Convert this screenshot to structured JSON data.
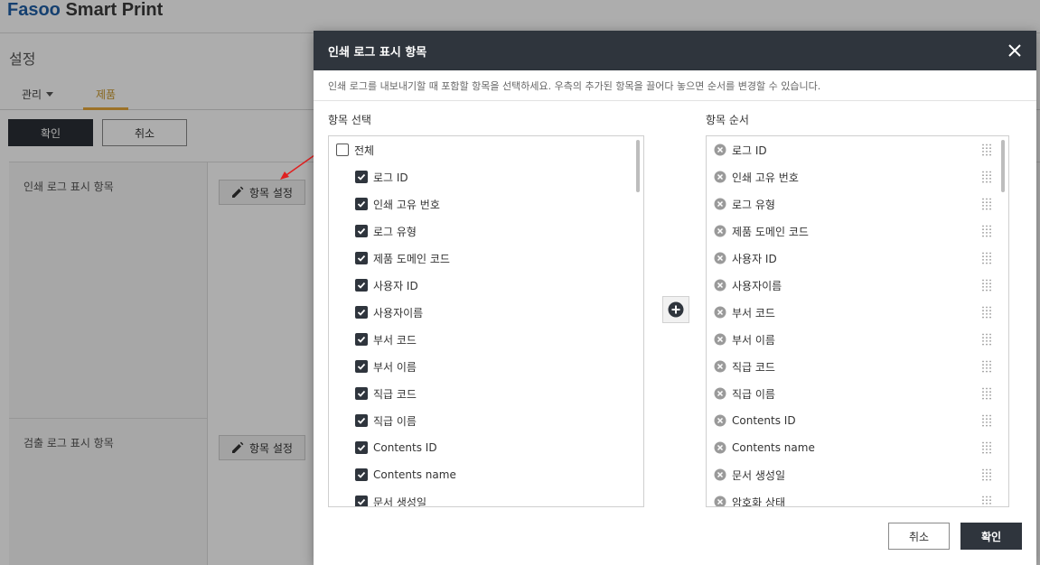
{
  "app": {
    "logo_brand": "Fasoo",
    "logo_product": " Smart Print",
    "page_title": "설정",
    "tabs": [
      {
        "label": "관리"
      },
      {
        "label": "제품"
      }
    ],
    "confirm_label": "확인",
    "cancel_label": "취소",
    "rows": [
      {
        "label": "인쇄 로그 표시 항목",
        "button_label": "항목 설정"
      },
      {
        "label": "검출 로그 표시 항목",
        "button_label": "항목 설정"
      }
    ]
  },
  "modal": {
    "title": "인쇄 로그 표시 항목",
    "description": "인쇄 로그를 내보내기할 때 포함할 항목을 선택하세요. 우측의 추가된 항목을 끌어다 놓으면 순서를 변경할 수 있습니다.",
    "select_label": "항목 선택",
    "order_label": "항목 순서",
    "select_all_label": "전체",
    "select_items": [
      {
        "label": "로그 ID",
        "checked": true
      },
      {
        "label": "인쇄 고유 번호",
        "checked": true
      },
      {
        "label": "로그 유형",
        "checked": true
      },
      {
        "label": "제품 도메인 코드",
        "checked": true
      },
      {
        "label": "사용자 ID",
        "checked": true
      },
      {
        "label": "사용자이름",
        "checked": true
      },
      {
        "label": "부서 코드",
        "checked": true
      },
      {
        "label": "부서 이름",
        "checked": true
      },
      {
        "label": "직급 코드",
        "checked": true
      },
      {
        "label": "직급 이름",
        "checked": true
      },
      {
        "label": "Contents ID",
        "checked": true
      },
      {
        "label": "Contents name",
        "checked": true
      },
      {
        "label": "문서 생성일",
        "checked": true
      }
    ],
    "order_items": [
      {
        "label": "로그 ID"
      },
      {
        "label": "인쇄 고유 번호"
      },
      {
        "label": "로그 유형"
      },
      {
        "label": "제품 도메인 코드"
      },
      {
        "label": "사용자 ID"
      },
      {
        "label": "사용자이름"
      },
      {
        "label": "부서 코드"
      },
      {
        "label": "부서 이름"
      },
      {
        "label": "직급 코드"
      },
      {
        "label": "직급 이름"
      },
      {
        "label": "Contents ID"
      },
      {
        "label": "Contents name"
      },
      {
        "label": "문서 생성일"
      },
      {
        "label": "암호화 상태"
      }
    ],
    "cancel_label": "취소",
    "confirm_label": "확인"
  },
  "colors": {
    "header_dark": "#2f353d",
    "accent_tab": "#e6a93b",
    "brand_blue": "#1f5fa6",
    "annotation_arrow": "#e02020"
  }
}
